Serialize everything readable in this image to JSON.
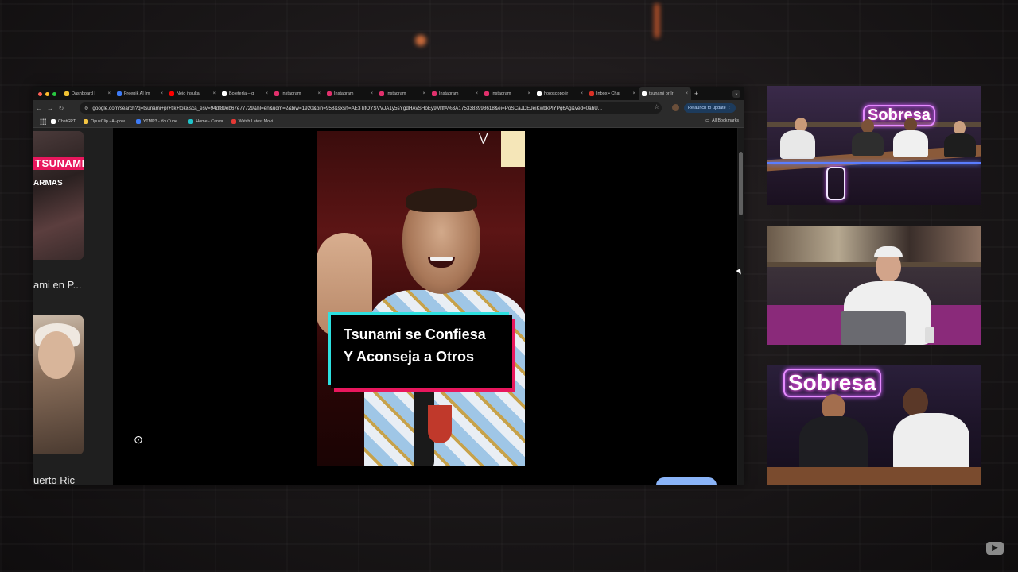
{
  "browser": {
    "tabs": [
      {
        "label": "Dashboard |",
        "color": "#f1c232"
      },
      {
        "label": "Freepik AI Im",
        "color": "#3d7bf7"
      },
      {
        "label": "Ñejo insulta",
        "color": "#ff0000"
      },
      {
        "label": "Boletería – g",
        "color": "#ffffff"
      },
      {
        "label": "Instagram",
        "color": "#e1306c"
      },
      {
        "label": "Instagram",
        "color": "#e1306c"
      },
      {
        "label": "Instagram",
        "color": "#e1306c"
      },
      {
        "label": "Instagram",
        "color": "#e1306c"
      },
      {
        "label": "Instagram",
        "color": "#e1306c"
      },
      {
        "label": "horoscopo ir",
        "color": "#ffffff"
      },
      {
        "label": "Inbox • Chat",
        "color": "#d93025"
      },
      {
        "label": "tsunami pr Ir",
        "color": "#ffffff"
      }
    ],
    "url": "google.com/search?q=tsunami+pr+tik+tok&sca_esv=94df89eb67e77729&hl=en&udm=2&biw=1920&bih=958&sxsrf=AE3TifOYSVVJA1y5sYgdHAvSHoEy9MflfA%3A1753383998618&ei=PoSCaJDEJeiKwbkPlYPg6Ag&ved=0ahU...",
    "relaunch_label": "Relaunch to update",
    "bookmarks": [
      {
        "label": "ChatGPT",
        "color": "#ffffff"
      },
      {
        "label": "OpusClip - AI-pow...",
        "color": "#f5c542"
      },
      {
        "label": "YTMP3 - YouTube...",
        "color": "#3d7bf7"
      },
      {
        "label": "Home - Canva",
        "color": "#20c4cb"
      },
      {
        "label": "Watch Latest Movi...",
        "color": "#e53935"
      }
    ],
    "all_bookmarks_label": "All Bookmarks"
  },
  "results": {
    "left_tag": "TSUNAMI",
    "left_sub": "ARMAS",
    "left_caption": "ami en P...",
    "left_caption2": "uerto Ric"
  },
  "video": {
    "caption_line1": "Tsunami se Confiesa",
    "caption_line2": "Y Aconseja a Otros"
  },
  "cams": {
    "sign1": "Sobresa",
    "sign3": "Sobresa"
  },
  "colors": {
    "accent_pink": "#e8175d",
    "accent_cyan": "#2de0e0",
    "neon_purple": "#d05cff"
  }
}
